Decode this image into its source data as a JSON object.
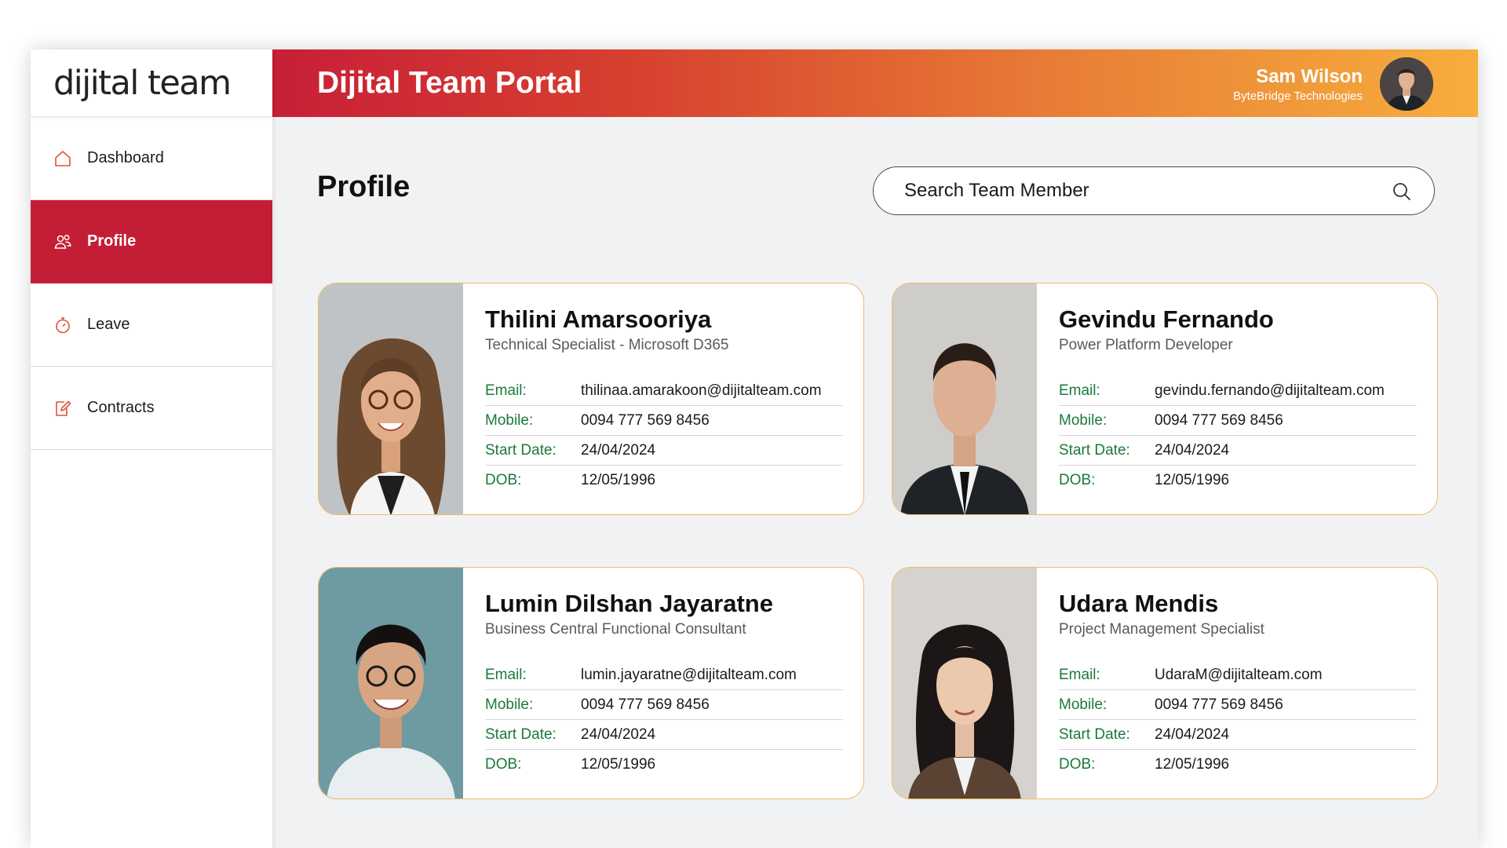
{
  "brand": {
    "logo_text": "dijital team"
  },
  "header": {
    "title": "Dijital Team Portal"
  },
  "user": {
    "name": "Sam Wilson",
    "org": "ByteBridge Technologies"
  },
  "sidebar": {
    "items": [
      {
        "label": "Dashboard",
        "icon": "home-icon"
      },
      {
        "label": "Profile",
        "icon": "users-icon",
        "active": true
      },
      {
        "label": "Leave",
        "icon": "stopwatch-icon"
      },
      {
        "label": "Contracts",
        "icon": "edit-document-icon"
      }
    ]
  },
  "page": {
    "title": "Profile"
  },
  "search": {
    "placeholder": "Search Team Member"
  },
  "field_labels": {
    "email": "Email:",
    "mobile": "Mobile:",
    "start": "Start Date:",
    "dob": "DOB:"
  },
  "members": [
    {
      "name": "Thilini Amarsooriya",
      "role": "Technical Specialist - Microsoft D365",
      "email": "thilinaa.amarakoon@dijitalteam.com",
      "mobile": "0094 777 569 8456",
      "start": "24/04/2024",
      "dob": "12/05/1996"
    },
    {
      "name": "Gevindu Fernando",
      "role": "Power Platform Developer",
      "email": "gevindu.fernando@dijitalteam.com",
      "mobile": "0094 777 569 8456",
      "start": "24/04/2024",
      "dob": "12/05/1996"
    },
    {
      "name": "Lumin Dilshan Jayaratne",
      "role": "Business Central Functional Consultant",
      "email": "lumin.jayaratne@dijitalteam.com",
      "mobile": "0094 777 569 8456",
      "start": "24/04/2024",
      "dob": "12/05/1996"
    },
    {
      "name": "Udara Mendis",
      "role": "Project Management Specialist",
      "email": "UdaraM@dijitalteam.com",
      "mobile": "0094 777 569 8456",
      "start": "24/04/2024",
      "dob": "12/05/1996"
    }
  ],
  "colors": {
    "accent_red": "#c41e36",
    "gradient_end": "#f7ae3d",
    "label_green": "#1a7a3a",
    "card_border": "#f2b862"
  }
}
